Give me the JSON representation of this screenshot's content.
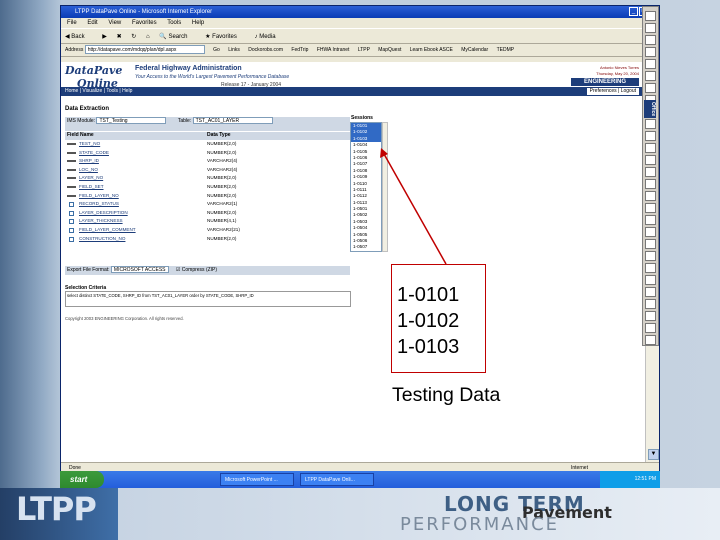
{
  "browser": {
    "title": "LTPP DataPave Online - Microsoft Internet Explorer",
    "menu": [
      "File",
      "Edit",
      "View",
      "Favorites",
      "Tools",
      "Help"
    ],
    "toolbar": [
      "Back",
      "Search",
      "Favorites",
      "Media"
    ],
    "address_label": "Address",
    "address_value": "http://datapave.com/mdqq/plan/dpl.aspx",
    "go_label": "Go",
    "links_label": "Links",
    "links": [
      "Dockorobs.com",
      "FedTrip",
      "FHWA Intranet",
      "LTPP",
      "MapQuest",
      "Learn Ebook ASCE",
      "MyCalendar",
      "TEDMP"
    ],
    "status_text": "Done",
    "zone_text": "Internet"
  },
  "page": {
    "logo_line1": "DataPave",
    "logo_line2": "Online",
    "agency": "Federal Highway Administration",
    "tagline": "Your Access to the World's Largest Pavement Performance Database",
    "release": "Release 17 - January 2004",
    "user_line1": "Antonio Nieves Torres",
    "user_line2": "Thursday, May 20, 2004",
    "badge": "ENGINEERING",
    "nav": "Home | Visualize | Tools | Help",
    "prefs": "Preferences | Logout",
    "section_title": "Data Extraction",
    "ims_label": "IMS Module:",
    "ims_value": "TST_Testing",
    "table_label": "Table:",
    "table_value": "TST_AC01_LAYER",
    "sessions_label": "Sessions",
    "col_field": "Field Name",
    "col_type": "Data Type",
    "fields": [
      {
        "name": "TEST_NO",
        "type": "NUMBER(2,0)",
        "mark": "key"
      },
      {
        "name": "STATE_CODE",
        "type": "NUMBER(2,0)",
        "mark": "key"
      },
      {
        "name": "SHRP_ID",
        "type": "VARCHAR2(4)",
        "mark": "key"
      },
      {
        "name": "LOC_NO",
        "type": "VARCHAR2(4)",
        "mark": "key"
      },
      {
        "name": "LAYER_NO",
        "type": "NUMBER(2,0)",
        "mark": "key"
      },
      {
        "name": "FIELD_SET",
        "type": "NUMBER(2,0)",
        "mark": "key"
      },
      {
        "name": "FIELD_LAYER_NO",
        "type": "NUMBER(2,0)",
        "mark": "key"
      },
      {
        "name": "RECORD_STATUS",
        "type": "VARCHAR2(1)",
        "mark": "check"
      },
      {
        "name": "LAYER_DESCRIPTION",
        "type": "NUMBER(2,0)",
        "mark": "check"
      },
      {
        "name": "LAYER_THICKNESS",
        "type": "NUMBER(4,1)",
        "mark": "check"
      },
      {
        "name": "FIELD_LAYER_COMMENT",
        "type": "VARCHAR2(21)",
        "mark": "check"
      },
      {
        "name": "CONSTRUCTION_NO",
        "type": "NUMBER(2,0)",
        "mark": "check"
      }
    ],
    "sessions": [
      "1-0101",
      "1-0102",
      "1-0103",
      "1-0104",
      "1-0105",
      "1-0106",
      "1-0107",
      "1-0108",
      "1-0109",
      "1-0110",
      "1-0111",
      "1-0112",
      "1-0113",
      "1-0501",
      "1-0502",
      "1-0503",
      "1-0504",
      "1-0505",
      "1-0506",
      "1-0507",
      "1-0508"
    ],
    "export_label": "Export File Format:",
    "export_value": "MICROSOFT ACCESS",
    "compress_label": "Compress (ZIP)",
    "export_button": "Export",
    "criteria_title": "Selection Criteria",
    "criteria_text": "select distinct STATE_CODE, SHRP_ID from TST_AC01_LAYER order by STATE_CODE, SHRP_ID",
    "copyright": "Copyright 2003 ENGINEERING Corporation. All rights reserved."
  },
  "taskbar": {
    "start": "start",
    "tasks": [
      "Microsoft PowerPoint ...",
      "LTPP DataPave Onli..."
    ],
    "clock": "12:51 PM"
  },
  "office_bar_label": "Office",
  "callout": {
    "lines": [
      "1-0101",
      "1-0102",
      "1-0103"
    ],
    "note": "Testing Data"
  },
  "footer": {
    "ltpp": "LTPP",
    "brand_line1": "LONG TERM",
    "brand_line2": "Pavement",
    "brand_line3": "PERFORMANCE"
  },
  "colors": {
    "accent": "#1d3d7a",
    "callout_border": "#c00000",
    "selection": "#316ac5"
  }
}
